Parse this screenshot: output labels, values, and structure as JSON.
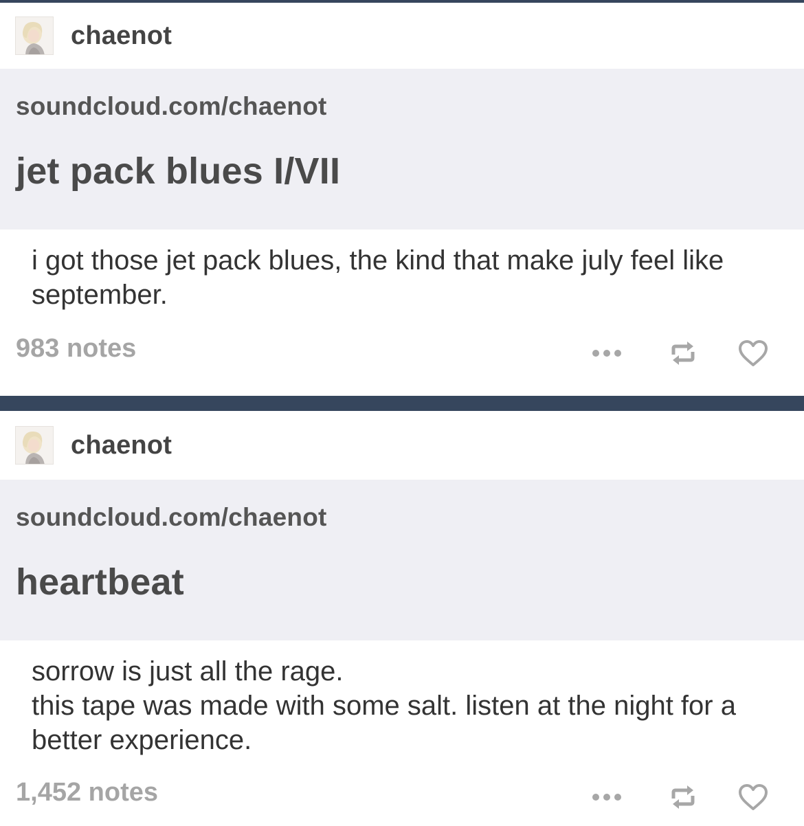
{
  "posts": [
    {
      "username": "chaenot",
      "link_url": "soundcloud.com/chaenot",
      "link_title": "jet pack blues I/VII",
      "caption": "i got those jet pack blues, the kind that make july feel like september.",
      "notes": "983 notes"
    },
    {
      "username": "chaenot",
      "link_url": "soundcloud.com/chaenot",
      "link_title": "heartbeat",
      "caption_lines": [
        "sorrow is just all the rage.",
        "this tape was made with some salt. listen at the night for a better experience."
      ],
      "notes": "1,452 notes"
    }
  ],
  "icons": {
    "more": "more-icon",
    "reblog": "reblog-icon",
    "like": "heart-icon"
  },
  "colors": {
    "divider": "#36465d",
    "link_block_bg": "#efeff4",
    "notes_text": "#a5a5a5"
  }
}
